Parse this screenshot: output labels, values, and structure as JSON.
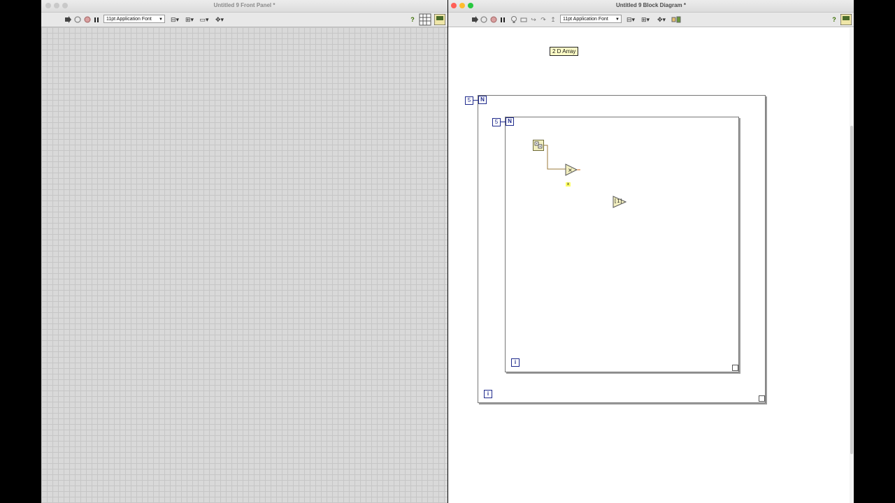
{
  "front_panel": {
    "title": "Untitled 9 Front Panel *",
    "font": "11pt Application Font"
  },
  "block_diagram": {
    "title": "Untitled 9 Block Diagram *",
    "font": "11pt Application Font",
    "label": "2 D Array",
    "outer_loop": {
      "count": "5",
      "n_label": "N",
      "i_label": "i"
    },
    "inner_loop": {
      "count": "5",
      "n_label": "N",
      "i_label": "i"
    },
    "multiply_constant": "x",
    "numeric_function_glyph": "[1]"
  },
  "colors": {
    "close": "#ff5f57",
    "minimize": "#febc2e",
    "zoom": "#28c840",
    "loop_terminal": "#1f2a8c",
    "label_bg": "#fffec8",
    "wire": "#9b7a38"
  },
  "icons": [
    "run-arrow-icon",
    "run-continuous-icon",
    "abort-icon",
    "pause-icon",
    "highlight-execution-icon",
    "retain-wire-icon",
    "step-into-icon",
    "step-over-icon",
    "step-out-icon",
    "align-icon",
    "distribute-icon",
    "resize-icon",
    "reorder-icon",
    "cleanup-icon",
    "help-icon",
    "vi-icon"
  ]
}
